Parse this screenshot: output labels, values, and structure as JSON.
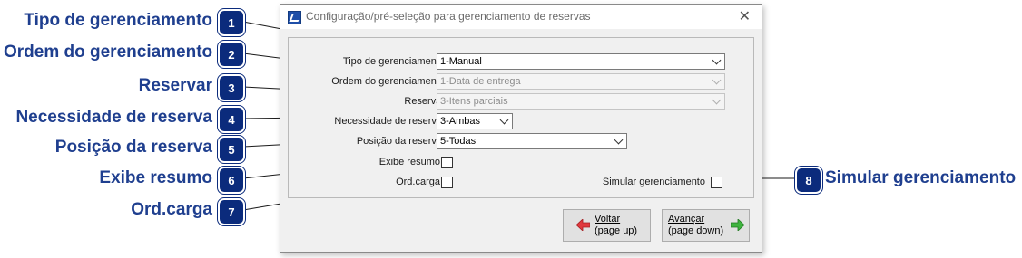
{
  "callouts": [
    {
      "num": "1",
      "label": "Tipo de gerenciamento"
    },
    {
      "num": "2",
      "label": "Ordem do gerenciamento"
    },
    {
      "num": "3",
      "label": "Reservar"
    },
    {
      "num": "4",
      "label": "Necessidade de reserva"
    },
    {
      "num": "5",
      "label": "Posição da reserva"
    },
    {
      "num": "6",
      "label": "Exibe resumo"
    },
    {
      "num": "7",
      "label": "Ord.carga"
    },
    {
      "num": "8",
      "label": "Simular gerenciamento"
    }
  ],
  "dialog": {
    "title": "Configuração/pré-seleção para gerenciamento de reservas",
    "close_glyph": "✕"
  },
  "form": {
    "tipo": {
      "label": "Tipo de gerenciamento",
      "value": "1-Manual"
    },
    "ordem": {
      "label": "Ordem do gerenciamento",
      "value": "1-Data de entrega"
    },
    "reservar": {
      "label": "Reservar",
      "value": "3-Itens parciais"
    },
    "necessidade": {
      "label": "Necessidade de reserva",
      "value": "3-Ambas"
    },
    "posicao": {
      "label": "Posição da reserva",
      "value": "5-Todas"
    },
    "exibe_resumo": {
      "label": "Exibe resumo",
      "checked": false
    },
    "ord_carga": {
      "label": "Ord.carga",
      "checked": false
    },
    "simular": {
      "label": "Simular gerenciamento",
      "checked": false
    }
  },
  "buttons": {
    "voltar": {
      "line1": "Voltar",
      "line2": "(page up)"
    },
    "avancar": {
      "line1": "Avançar",
      "line2": "(page down)"
    }
  },
  "colors": {
    "callout_text": "#1f3f8f",
    "badge": "#0b2b7c",
    "arrow_back": "#e0393e",
    "arrow_next": "#3fb33f"
  }
}
